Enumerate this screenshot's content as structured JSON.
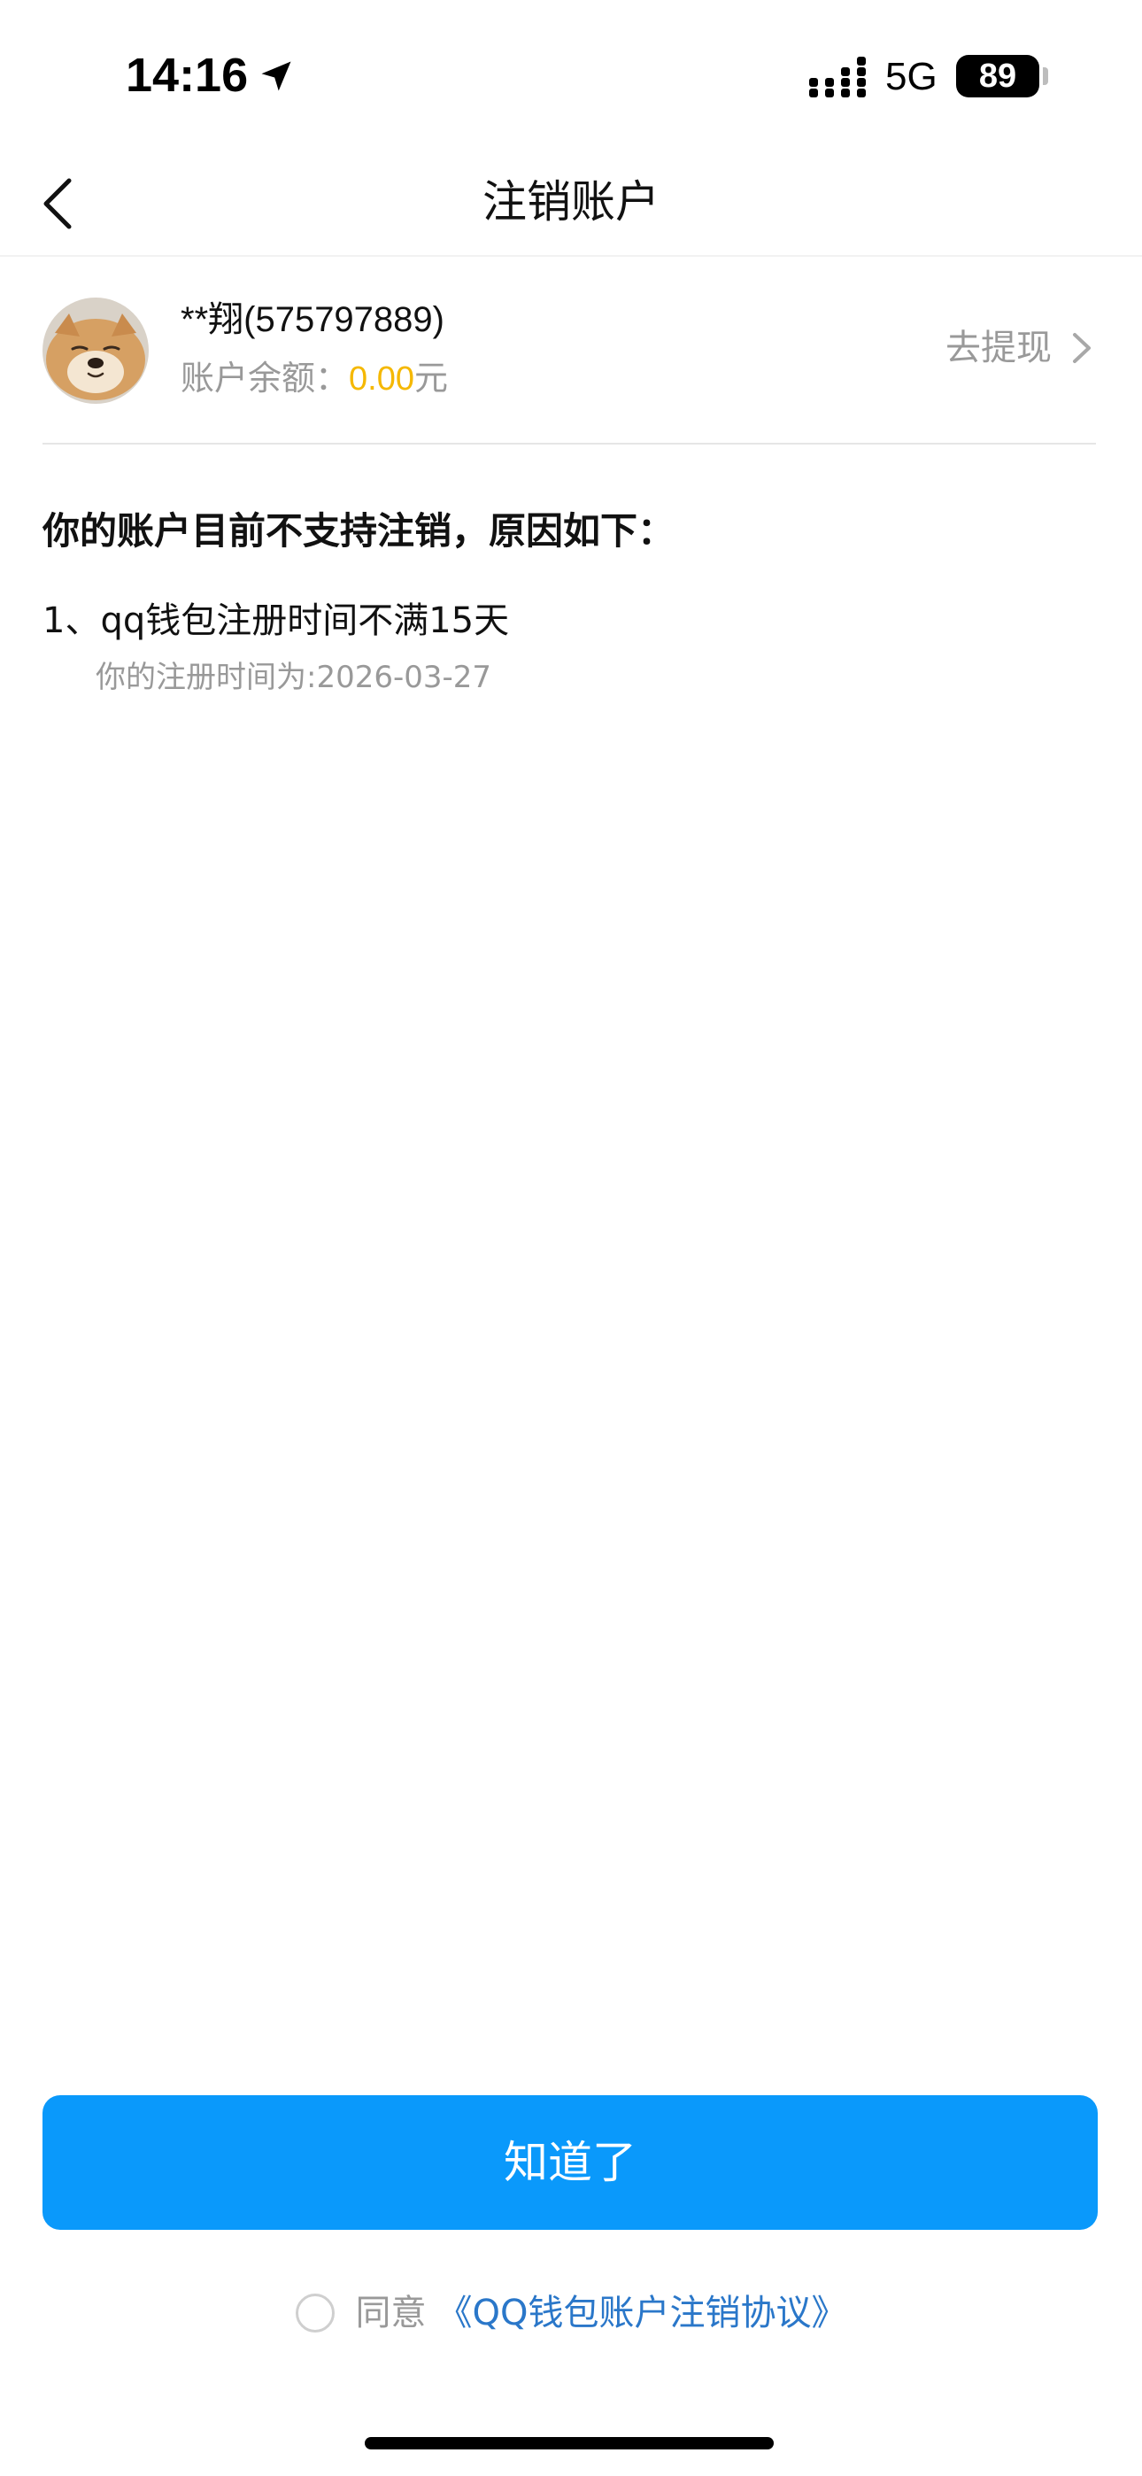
{
  "status_bar": {
    "time": "14:16",
    "network": "5G",
    "battery": "89"
  },
  "nav": {
    "title": "注销账户"
  },
  "account": {
    "name": "**翔(575797889)",
    "balance_label": "账户余额：",
    "balance_value": "0.00",
    "balance_unit": "元",
    "withdraw_label": "去提现"
  },
  "reasons": {
    "heading": "你的账户目前不支持注销，原因如下：",
    "items": [
      {
        "text": "1、qq钱包注册时间不满15天",
        "detail": "你的注册时间为:2026-03-27"
      }
    ]
  },
  "footer": {
    "ok_button": "知道了",
    "agree_label": "同意",
    "agreement_link": "《QQ钱包账户注销协议》"
  },
  "colors": {
    "primary_button": "#0a99fb",
    "balance": "#f5b800",
    "link": "#2a77c9",
    "secondary_text": "#999999"
  }
}
